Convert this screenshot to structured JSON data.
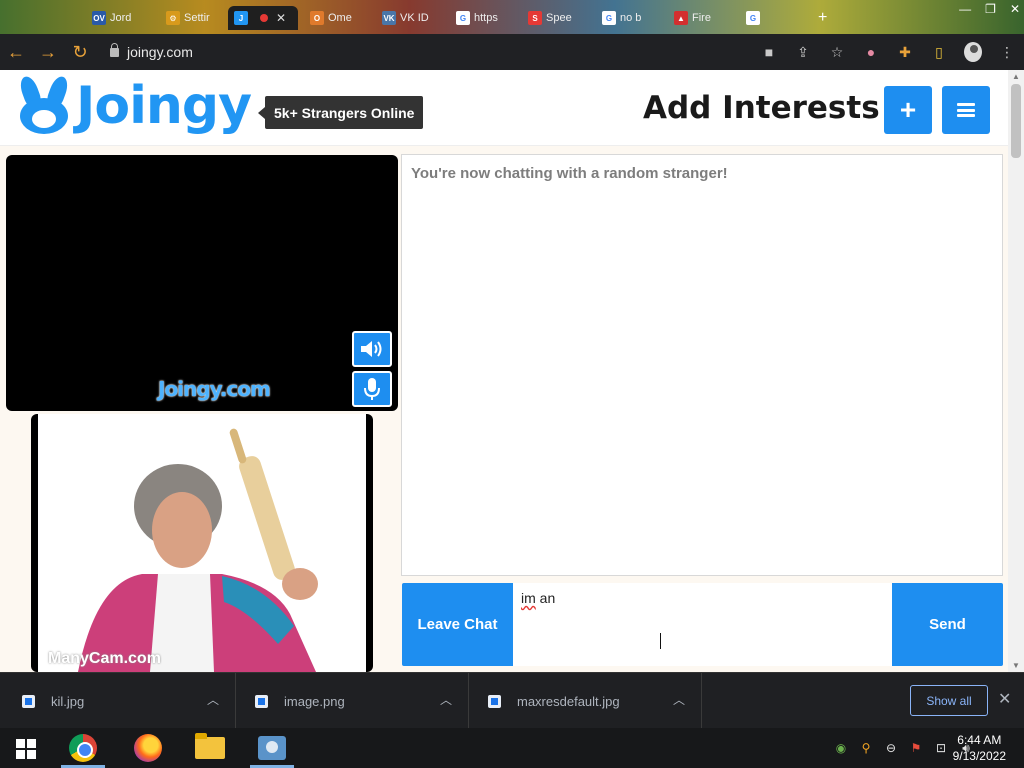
{
  "browser": {
    "tabs": [
      {
        "label": "Jord",
        "favicon": "ov-icon",
        "color": "#2a5aa8"
      },
      {
        "label": "Settir",
        "favicon": "gear-icon",
        "color": "#d89a1c"
      },
      {
        "label": "",
        "favicon": "joingy-icon",
        "color": "#2196f3",
        "active": true
      },
      {
        "label": "Ome",
        "favicon": "omegle-icon",
        "color": "#e07a2c"
      },
      {
        "label": "VK ID",
        "favicon": "vk-icon",
        "color": "#4a76a8"
      },
      {
        "label": "https",
        "favicon": "google-icon",
        "color": "#4285f4"
      },
      {
        "label": "Spee",
        "favicon": "speedtest-icon",
        "color": "#e53935"
      },
      {
        "label": "no b",
        "favicon": "google-icon",
        "color": "#4285f4"
      },
      {
        "label": "Fire",
        "favicon": "tree-icon",
        "color": "#d32f2f"
      },
      {
        "label": "",
        "favicon": "google-icon",
        "color": "#4285f4"
      }
    ],
    "url": "joingy.com"
  },
  "site": {
    "logo_text": "Joingy",
    "online_badge": "5k+ Strangers Online",
    "add_interests": "Add Interests",
    "watermark": "Joingy.com",
    "self_watermark": "ManyCam.com",
    "chat_status": "You're now chatting with a random stranger!",
    "input_word1": "im",
    "input_word2": " an",
    "leave_label": "Leave Chat",
    "send_label": "Send",
    "accent": "#1e8ef0"
  },
  "downloads": {
    "items": [
      {
        "name": "kil.jpg"
      },
      {
        "name": "image.png"
      },
      {
        "name": "maxresdefault.jpg"
      }
    ],
    "show_all": "Show all"
  },
  "taskbar": {
    "time": "6:44 AM",
    "date": "9/13/2022"
  }
}
